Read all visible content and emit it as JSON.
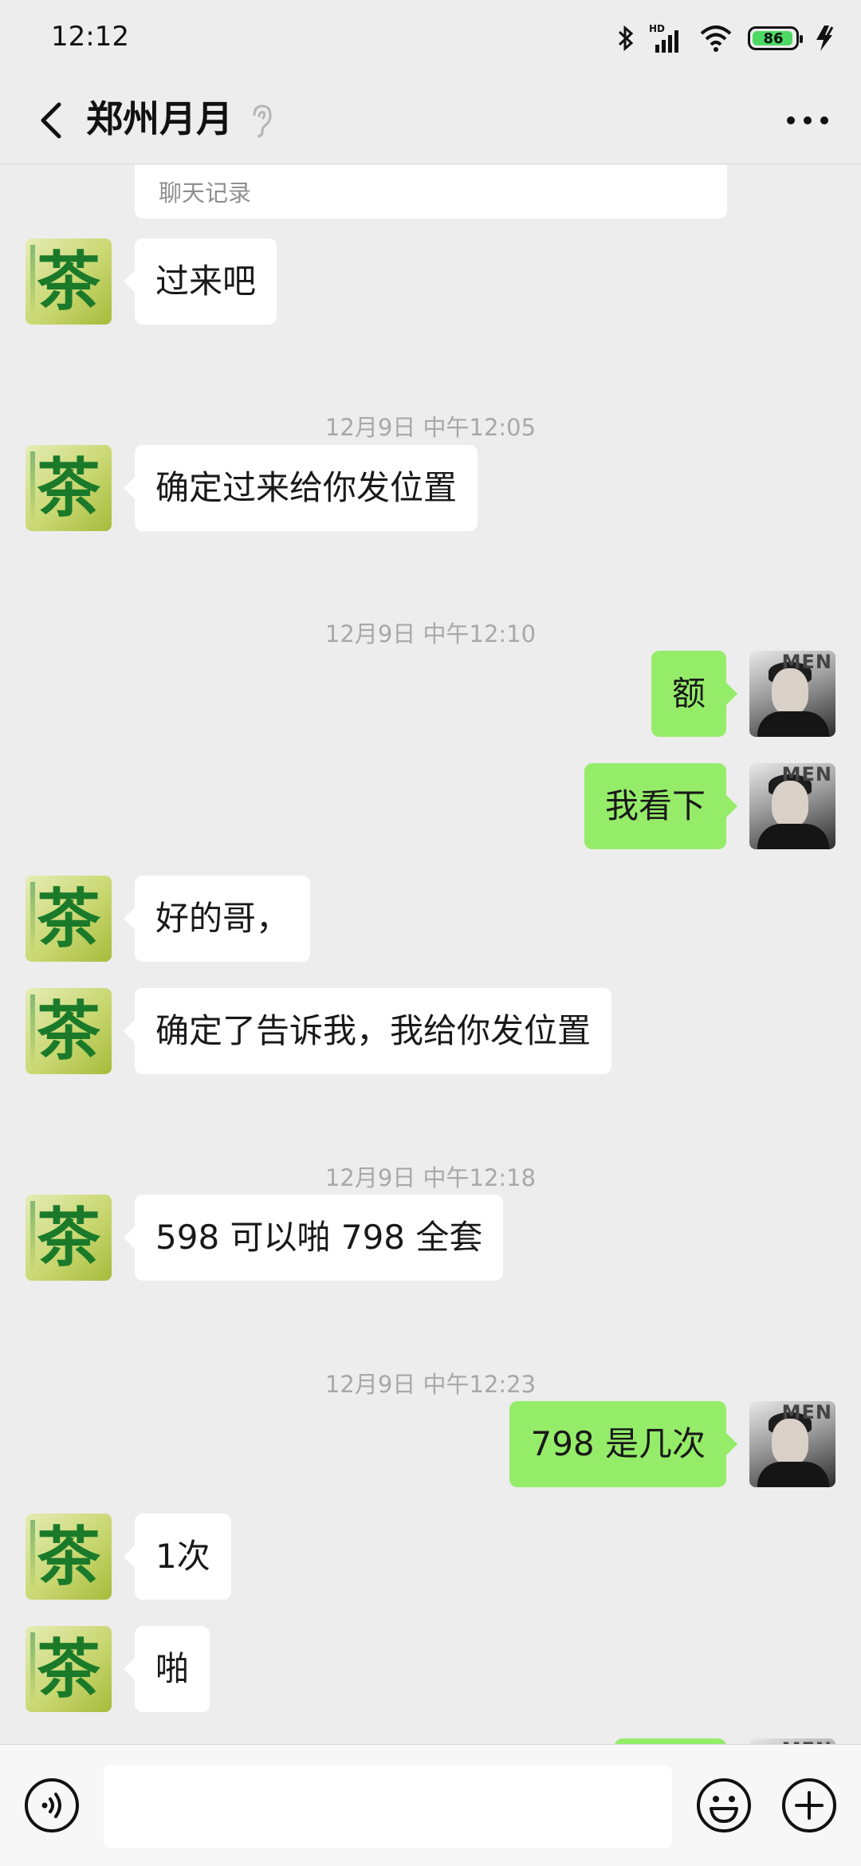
{
  "status_bar": {
    "time": "12:12",
    "battery": "86",
    "icons": [
      "bluetooth-icon",
      "hd-signal-icon",
      "wifi-icon",
      "battery-icon",
      "charging-icon"
    ]
  },
  "nav": {
    "title": "郑州月月",
    "back_icon": "chevron-left-icon",
    "ear_icon": "ear-icon",
    "more_icon": "more-dots-icon"
  },
  "chat": {
    "record_card": "聊天记录",
    "items": [
      {
        "kind": "in",
        "text": "过来吧"
      },
      {
        "kind": "time",
        "text": "12月9日 中午12:05"
      },
      {
        "kind": "in",
        "text": "确定过来给你发位置"
      },
      {
        "kind": "time",
        "text": "12月9日 中午12:10"
      },
      {
        "kind": "out",
        "text": "额"
      },
      {
        "kind": "out",
        "text": "我看下"
      },
      {
        "kind": "in",
        "text": "好的哥，"
      },
      {
        "kind": "in",
        "text": "确定了告诉我，我给你发位置"
      },
      {
        "kind": "time",
        "text": "12月9日 中午12:18"
      },
      {
        "kind": "in",
        "text": "598 可以啪 798 全套"
      },
      {
        "kind": "time",
        "text": "12月9日 中午12:23"
      },
      {
        "kind": "out",
        "text": "798 是几次"
      },
      {
        "kind": "in",
        "text": "1次"
      },
      {
        "kind": "in",
        "text": "啪"
      },
      {
        "kind": "out",
        "text": ""
      }
    ],
    "incoming_avatar_text": "茶",
    "outgoing_avatar_text": "MEN"
  },
  "input_bar": {
    "voice_icon": "voice-icon",
    "emoji_icon": "emoji-icon",
    "plus_icon": "plus-icon",
    "placeholder": ""
  },
  "colors": {
    "background": "#ededed",
    "outgoing_bubble": "#95ec69",
    "incoming_bubble": "#ffffff",
    "timestamp": "#a8a8a8"
  }
}
